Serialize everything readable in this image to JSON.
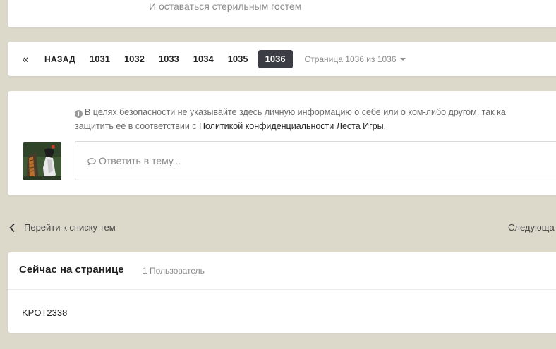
{
  "top_fragment": "И оставаться стерильным гостем",
  "pagination": {
    "first_label": "«",
    "prev_label": "НАЗАД",
    "pages": [
      "1031",
      "1032",
      "1033",
      "1034",
      "1035"
    ],
    "current_page": "1036",
    "page_info": "Страница 1036 из 1036"
  },
  "reply": {
    "notice_prefix": "В целях безопасности не указывайте здесь личную информацию о себе или о ком-либо другом, так ка",
    "notice_line2": "защитить её в соответствии с ",
    "policy_link": "Политикой конфиденциальности Леста Игры",
    "notice_end": ".",
    "placeholder": "Ответить в тему..."
  },
  "nav": {
    "back_label": "Перейти к списку тем",
    "next_label": "Следующа"
  },
  "online": {
    "title": "Сейчас на странице",
    "count": "1 Пользователь",
    "users": [
      "KPOT2338"
    ]
  },
  "colors": {
    "background": "#dcd9cb",
    "active_page": "#3a3d44"
  }
}
